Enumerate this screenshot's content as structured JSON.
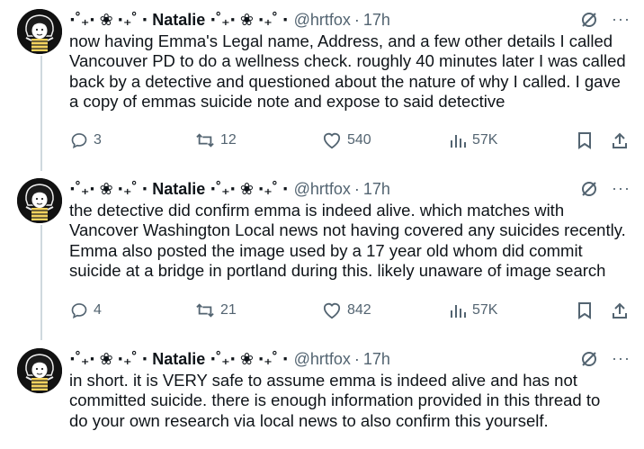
{
  "tweets": [
    {
      "name": "⋅˚₊‧ ❀ ‧₊˚ ⋅ Natalie ⋅˚₊‧ ❀ ‧₊˚ ⋅",
      "handle": "@hrtfox",
      "separator": "·",
      "time": "17h",
      "lines": [
        "now having Emma's Legal name, Address, and a few other details I called",
        "Vancouver PD to do a wellness check. roughly 40 minutes later I was called",
        "back by a detective and questioned about the nature of why I called. I gave",
        "a copy of emmas suicide note and expose to said detective"
      ],
      "replies": "3",
      "reposts": "12",
      "likes": "540",
      "views": "57K"
    },
    {
      "name": "⋅˚₊‧ ❀ ‧₊˚ ⋅ Natalie ⋅˚₊‧ ❀ ‧₊˚ ⋅",
      "handle": "@hrtfox",
      "separator": "·",
      "time": "17h",
      "lines": [
        "the detective did confirm emma is indeed alive. which matches with",
        "Vancover Washington Local news not having covered any suicides recently.",
        "Emma also posted the image used by a 17 year old whom did commit",
        "suicide at a bridge in portland during this. likely unaware of image search"
      ],
      "replies": "4",
      "reposts": "21",
      "likes": "842",
      "views": "57K"
    },
    {
      "name": "⋅˚₊‧ ❀ ‧₊˚ ⋅ Natalie ⋅˚₊‧ ❀ ‧₊˚ ⋅",
      "handle": "@hrtfox",
      "separator": "·",
      "time": "17h",
      "lines": [
        "in short. it is VERY safe to assume emma is indeed alive and has not",
        "committed suicide. there is enough information provided in this thread to",
        "do your own research via local news to also confirm this yourself."
      ]
    }
  ],
  "more_glyph": "···",
  "icons": {
    "avatar": "avatar-illustration",
    "grok": "grok-icon",
    "more": "more-icon",
    "reply": "reply-icon",
    "repost": "repost-icon",
    "like": "heart-icon",
    "views": "views-icon",
    "bookmark": "bookmark-icon",
    "share": "share-icon"
  },
  "colors": {
    "text": "#0f1419",
    "secondary": "#536471",
    "thread_line": "#cfd9de",
    "background": "#ffffff"
  }
}
